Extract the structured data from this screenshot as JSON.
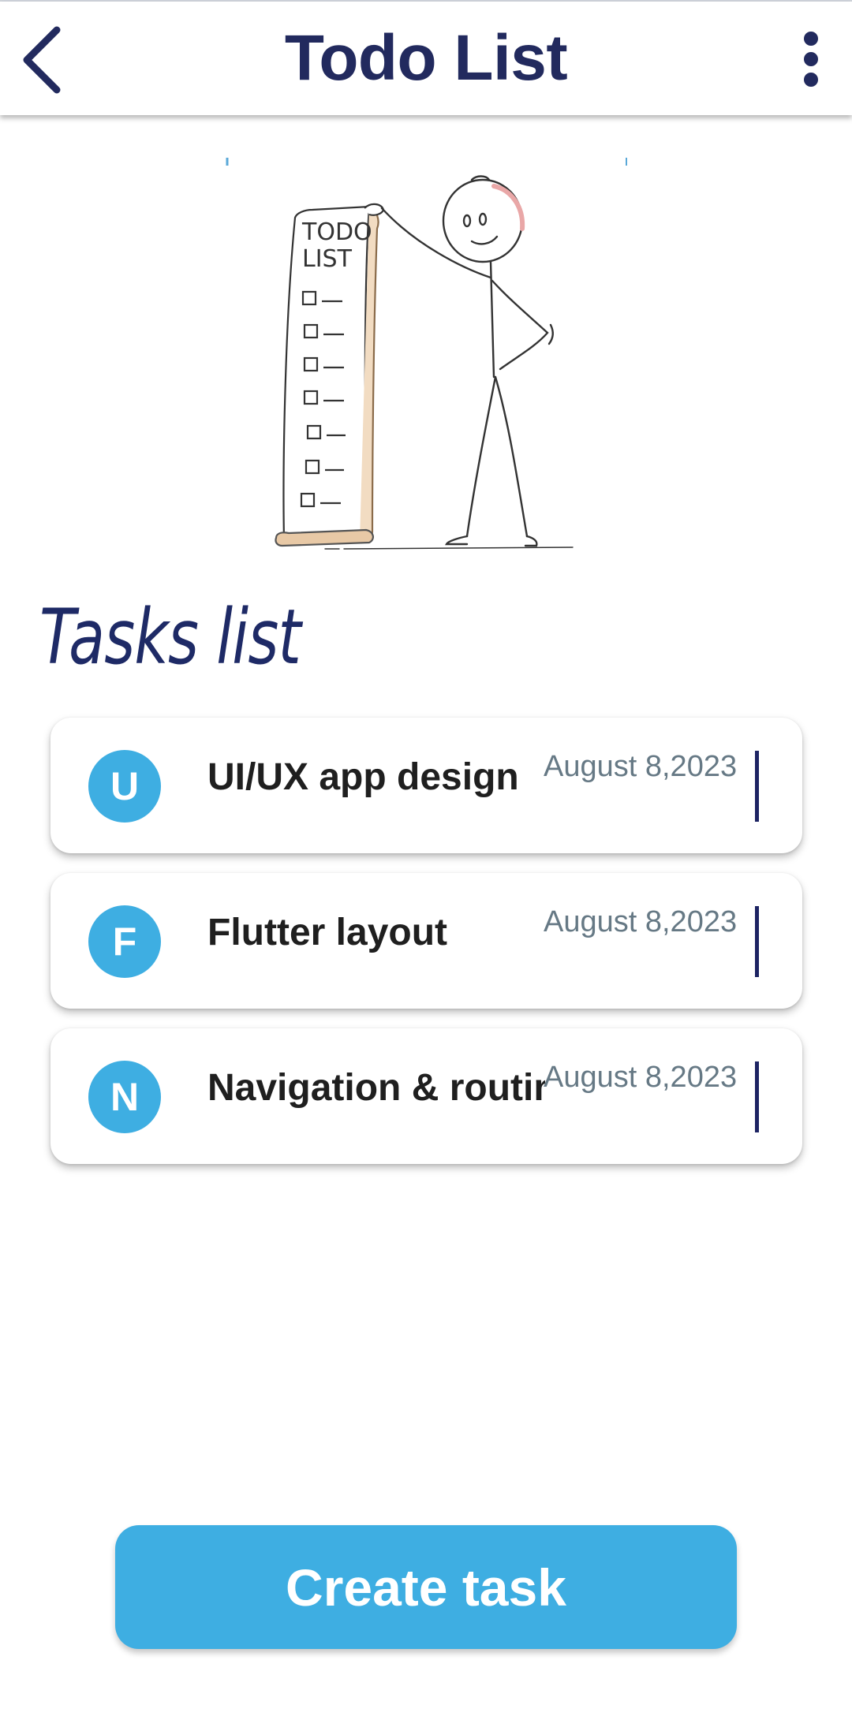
{
  "app_bar": {
    "title": "Todo List",
    "back_icon": "chevron-left-icon",
    "menu_icon": "more-vertical-icon",
    "color": "#222a5e"
  },
  "illustration": {
    "scroll_heading_line1": "TODO",
    "scroll_heading_line2": "LIST"
  },
  "section": {
    "title": "Tasks list"
  },
  "tasks": [
    {
      "initial": "U",
      "title": "UI/UX app design",
      "date": "August 8,2023"
    },
    {
      "initial": "F",
      "title": "Flutter layout",
      "date": "August 8,2023"
    },
    {
      "initial": "N",
      "title": "Navigation & routing",
      "date": "August 8,2023"
    }
  ],
  "create_button": {
    "label": "Create task",
    "color": "#3eaee2"
  }
}
